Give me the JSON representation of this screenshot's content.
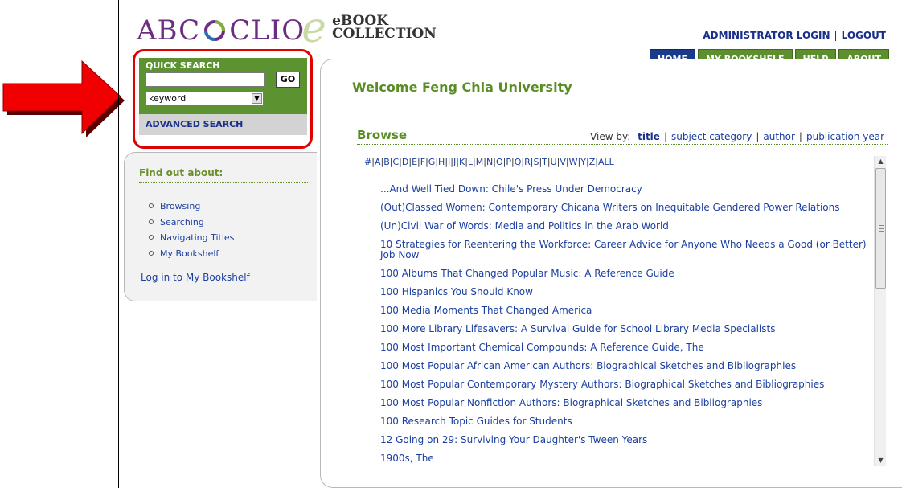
{
  "logo": {
    "abc": "ABC",
    "clio": "CLIO",
    "ebook": "eBOOK",
    "collection": "COLLECTION",
    "colors": {
      "purple": "#6b2e82",
      "green": "#c8dba4"
    }
  },
  "top_links": {
    "admin_login": "ADMINISTRATOR LOGIN",
    "separator": "|",
    "logout": "LOGOUT"
  },
  "nav_tabs": [
    {
      "label": "HOME",
      "active": true
    },
    {
      "label": "MY BOOKSHELF",
      "active": false
    },
    {
      "label": "HELP",
      "active": false
    },
    {
      "label": "ABOUT",
      "active": false
    }
  ],
  "quick_search": {
    "title": "QUICK SEARCH",
    "input_value": "",
    "go_label": "GO",
    "select_value": "keyword",
    "advanced_label": "ADVANCED SEARCH"
  },
  "find_out": {
    "title": "Find out about:",
    "items": [
      "Browsing",
      "Searching",
      "Navigating Titles",
      "My Bookshelf"
    ],
    "login_link": "Log in to My Bookshelf"
  },
  "main": {
    "welcome": "Welcome Feng Chia University",
    "browse_title": "Browse",
    "view_by": {
      "label": "View by:",
      "options": [
        "title",
        "subject category",
        "author",
        "publication year"
      ],
      "current": "title"
    },
    "alphabet": [
      "#",
      "A",
      "B",
      "C",
      "D",
      "E",
      "F",
      "G",
      "H",
      "I",
      "J",
      "K",
      "L",
      "M",
      "N",
      "O",
      "P",
      "Q",
      "R",
      "S",
      "T",
      "U",
      "V",
      "W",
      "Y",
      "Z",
      "ALL"
    ],
    "titles": [
      "...And Well Tied Down: Chile's Press Under Democracy",
      "(Out)Classed Women: Contemporary Chicana Writers on Inequitable Gendered Power Relations",
      "(Un)Civil War of Words: Media and Politics in the Arab World",
      "10 Strategies for Reentering the Workforce: Career Advice for Anyone Who Needs a Good (or Better) Job Now",
      "100 Albums That Changed Popular Music: A Reference Guide",
      "100 Hispanics You Should Know",
      "100 Media Moments That Changed America",
      "100 More Library Lifesavers: A Survival Guide for School Library Media Specialists",
      "100 Most Important Chemical Compounds: A Reference Guide, The",
      "100 Most Popular African American Authors: Biographical Sketches and Bibliographies",
      "100 Most Popular Contemporary Mystery Authors: Biographical Sketches and Bibliographies",
      "100 Most Popular Nonfiction Authors: Biographical Sketches and Bibliographies",
      "100 Research Topic Guides for Students",
      "12 Going on 29: Surviving Your Daughter's Tween Years",
      "1900s, The"
    ]
  },
  "colors": {
    "brand_green": "#5d9230",
    "nav_blue": "#1a3a8a",
    "link_blue": "#1a3fa0",
    "annotation_red": "#e00000"
  },
  "icons": {
    "dropdown": "chevron-down-icon",
    "arrow": "red-arrow-annotation",
    "scroll_up": "scroll-up-icon",
    "scroll_down": "scroll-down-icon"
  }
}
